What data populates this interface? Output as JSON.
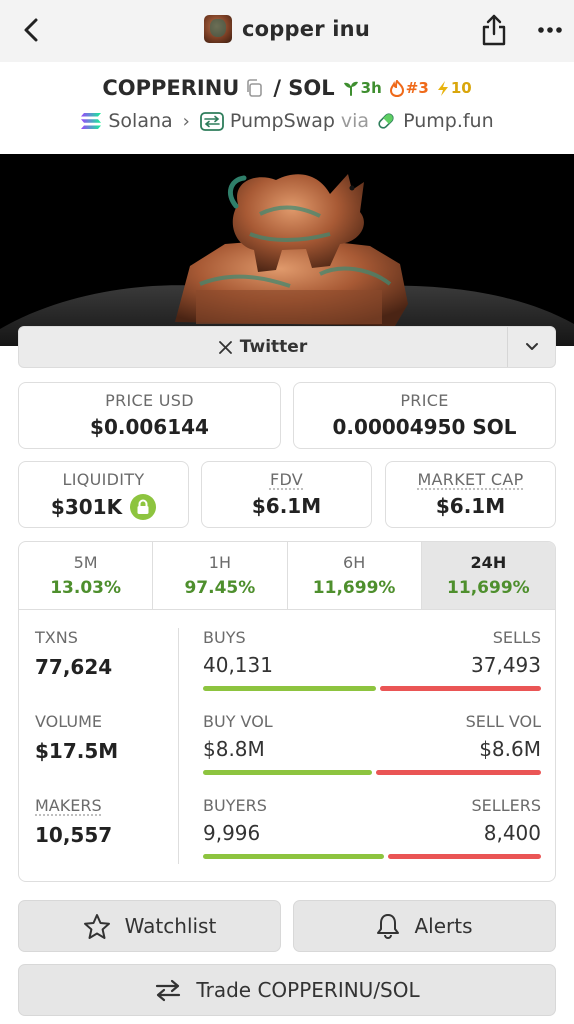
{
  "header": {
    "title": "copper inu",
    "back_icon": "chevron-left-icon",
    "share_icon": "share-icon",
    "more_icon": "more-horizontal-icon"
  },
  "pair": {
    "base": "COPPERINU",
    "quote": "/ SOL",
    "age": "3h",
    "rank": "#3",
    "boosts": "10"
  },
  "chain": {
    "network": "Solana",
    "dex": "PumpSwap",
    "via": "via",
    "launchpad": "Pump.fun"
  },
  "social": {
    "twitter_label": "Twitter"
  },
  "prices": {
    "usd_label": "PRICE USD",
    "usd_value": "$0.006144",
    "native_label": "PRICE",
    "native_value": "0.00004950 SOL"
  },
  "metrics": {
    "liquidity_label": "LIQUIDITY",
    "liquidity_value": "$301K",
    "fdv_label": "FDV",
    "fdv_value": "$6.1M",
    "mcap_label": "MARKET CAP",
    "mcap_value": "$6.1M"
  },
  "timeframes": [
    {
      "label": "5M",
      "change": "13.03%"
    },
    {
      "label": "1H",
      "change": "97.45%"
    },
    {
      "label": "6H",
      "change": "11,699%"
    },
    {
      "label": "24H",
      "change": "11,699%"
    }
  ],
  "stats": {
    "txns_label": "TXNS",
    "txns_value": "77,624",
    "volume_label": "VOLUME",
    "volume_value": "$17.5M",
    "makers_label": "MAKERS",
    "makers_value": "10,557",
    "buys_label": "BUYS",
    "buys_value": "40,131",
    "sells_label": "SELLS",
    "sells_value": "37,493",
    "buy_vol_label": "BUY VOL",
    "buy_vol_value": "$8.8M",
    "sell_vol_label": "SELL VOL",
    "sell_vol_value": "$8.6M",
    "buyers_label": "BUYERS",
    "buyers_value": "9,996",
    "sellers_label": "SELLERS",
    "sellers_value": "8,400",
    "buy_share_txns": 0.517,
    "buy_share_volume": 0.506,
    "buy_share_makers": 0.543
  },
  "actions": {
    "watchlist": "Watchlist",
    "alerts": "Alerts",
    "trade": "Trade COPPERINU/SOL"
  },
  "colors": {
    "positive": "#4e8f2d",
    "buy_bar": "#8dc43f",
    "sell_bar": "#ea5555"
  }
}
